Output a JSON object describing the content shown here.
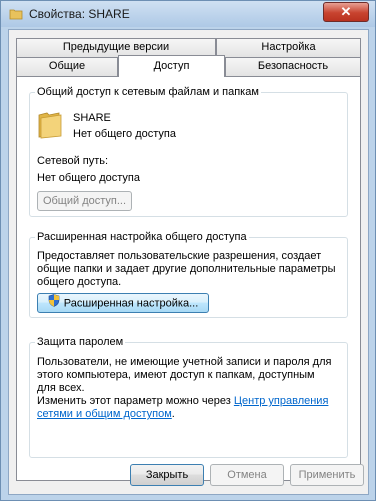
{
  "window": {
    "title": "Свойства: SHARE",
    "close_label": "✕"
  },
  "tabs": {
    "row1": [
      {
        "label": "Предыдущие версии"
      },
      {
        "label": "Настройка"
      }
    ],
    "row2": [
      {
        "label": "Общие"
      },
      {
        "label": "Доступ",
        "active": true
      },
      {
        "label": "Безопасность"
      }
    ]
  },
  "sharing": {
    "group_title": "Общий доступ к сетевым файлам и папкам",
    "folder_name": "SHARE",
    "folder_status": "Нет общего доступа",
    "network_path_label": "Сетевой путь:",
    "network_path_value": "Нет общего доступа",
    "share_button": "Общий доступ..."
  },
  "advanced": {
    "group_title": "Расширенная настройка общего доступа",
    "description": [
      "Предоставляет пользовательские разрешения, создает",
      "общие папки и задает другие дополнительные параметры",
      "общего доступа."
    ],
    "button": "Расширенная настройка..."
  },
  "password": {
    "group_title": "Защита паролем",
    "description": [
      "Пользователи, не имеющие учетной записи и пароля для",
      "этого компьютера, имеют доступ к папкам, доступным",
      "для всех."
    ],
    "change_prefix": "Изменить этот параметр можно через ",
    "link_part1": "Центр управления",
    "link_part2": "сетями и общим доступом",
    "suffix": "."
  },
  "footer": {
    "ok": "Закрыть",
    "cancel": "Отмена",
    "apply": "Применить"
  },
  "colors": {
    "link": "#0066cc",
    "disabled_text": "#838383"
  }
}
